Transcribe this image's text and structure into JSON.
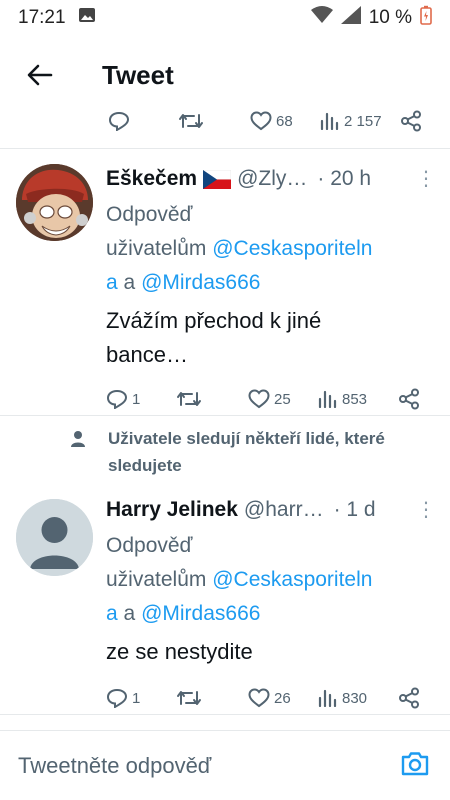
{
  "status_bar": {
    "time": "17:21",
    "battery": "10 %"
  },
  "header": {
    "title": "Tweet"
  },
  "top_actions": {
    "likes": "68",
    "views": "2 157"
  },
  "tweets": [
    {
      "name": "Eškečem",
      "handle": "@Zly…",
      "time": "· 20 h",
      "reply_prefix": "Odpověď",
      "reply_to": "uživatelům",
      "mention1": "@Ceskasporiteln",
      "mention1b": "a",
      "and": "a",
      "mention2": "@Mirdas666",
      "text": "Zvážím přechod k jiné bance…",
      "replies": "1",
      "likes": "25",
      "views": "853"
    },
    {
      "social_context": "Uživatele sledují někteří lidé, které sledujete",
      "name": "Harry Jelinek",
      "handle": "@harr…",
      "time": "· 1 d",
      "reply_prefix": "Odpověď",
      "reply_to": "uživatelům",
      "mention1": "@Ceskasporiteln",
      "mention1b": "a",
      "and": "a",
      "mention2": "@Mirdas666",
      "text": "ze se nestydite",
      "replies": "1",
      "likes": "26",
      "views": "830"
    }
  ],
  "compose": {
    "placeholder": "Tweetněte odpověď"
  },
  "colors": {
    "accent": "#1d9bf0",
    "secondary_text": "#536471"
  }
}
